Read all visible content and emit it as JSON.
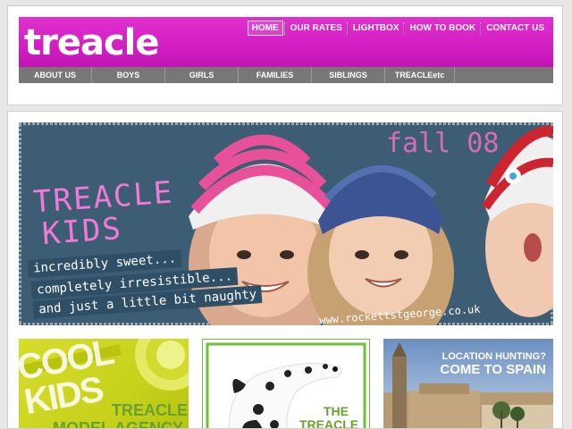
{
  "header": {
    "logo": "treacle",
    "top_nav": [
      {
        "label": "HOME",
        "active": true
      },
      {
        "label": "OUR RATES"
      },
      {
        "label": "LIGHTBOX"
      },
      {
        "label": "HOW TO BOOK"
      },
      {
        "label": "CONTACT US"
      }
    ],
    "sub_nav": [
      "ABOUT US",
      "BOYS",
      "GIRLS",
      "FAMILIES",
      "SIBLINGS",
      "TREACLEetc"
    ]
  },
  "banner": {
    "title_line1": "TREACLE",
    "title_line2": "KIDS",
    "season": "fall 08",
    "tagline": [
      "incredibly sweet...",
      "completely irresistible...",
      "and just a little bit naughty"
    ],
    "credit": "www.rockettstgeorge.co.uk"
  },
  "cards": {
    "cool_kids": {
      "big_text": [
        "COOL",
        "KIDS"
      ],
      "brand": "TREACLE",
      "sub": "MODEL AGENCY"
    },
    "dog": {
      "text": [
        "THE",
        "TREACLE"
      ]
    },
    "spain": {
      "question": "LOCATION HUNTING?",
      "headline": "COME TO SPAIN"
    }
  },
  "colors": {
    "brand_magenta": "#d422c6",
    "nav_grey": "#777777",
    "card_lime": "#cbd41f",
    "card_green": "#6fbf3a"
  }
}
